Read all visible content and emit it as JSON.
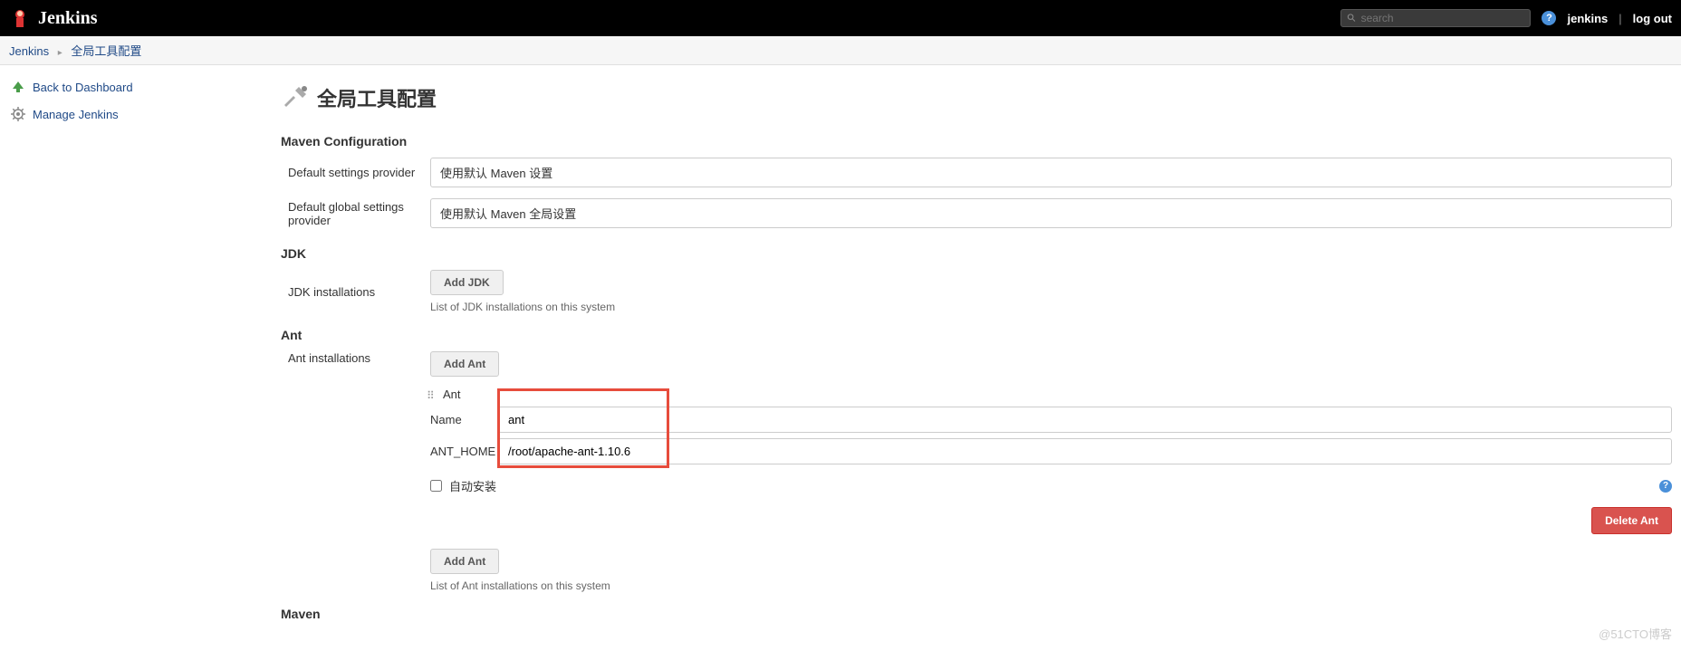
{
  "header": {
    "app_name": "Jenkins",
    "search_placeholder": "search",
    "user_link": "jenkins",
    "logout_link": "log out"
  },
  "breadcrumb": {
    "items": [
      "Jenkins",
      "全局工具配置"
    ]
  },
  "sidebar": {
    "items": [
      {
        "label": "Back to Dashboard",
        "icon": "up-arrow"
      },
      {
        "label": "Manage Jenkins",
        "icon": "gear"
      }
    ]
  },
  "page": {
    "title": "全局工具配置"
  },
  "maven": {
    "heading": "Maven Configuration",
    "default_settings_label": "Default settings provider",
    "default_settings_value": "使用默认 Maven 设置",
    "global_settings_label": "Default global settings provider",
    "global_settings_value": "使用默认 Maven 全局设置"
  },
  "jdk": {
    "heading": "JDK",
    "installations_label": "JDK installations",
    "add_button": "Add JDK",
    "help_text": "List of JDK installations on this system"
  },
  "ant": {
    "heading": "Ant",
    "installations_label": "Ant installations",
    "add_button": "Add Ant",
    "item_title": "Ant",
    "name_label": "Name",
    "name_value": "ant",
    "home_label": "ANT_HOME",
    "home_value": "/root/apache-ant-1.10.6",
    "auto_install_label": "自动安装",
    "delete_button": "Delete Ant",
    "add_button2": "Add Ant",
    "help_text": "List of Ant installations on this system"
  },
  "next_section": {
    "heading": "Maven"
  },
  "watermark": "@51CTO博客"
}
